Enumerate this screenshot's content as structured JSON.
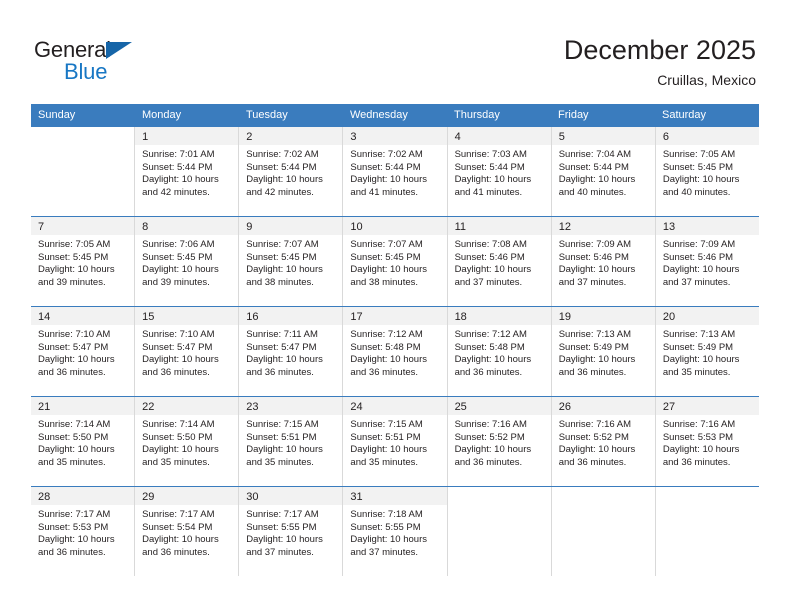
{
  "brand": {
    "name_top": "General",
    "name_bottom": "Blue",
    "accent_color": "#1877c4",
    "triangle_color": "#1665a8"
  },
  "header": {
    "title": "December 2025",
    "location": "Cruillas, Mexico"
  },
  "theme": {
    "header_row_bg": "#3a7cbe",
    "daynum_band_bg": "#f2f2f2",
    "cell_border": "#d9d9d9",
    "text_color": "#231f20"
  },
  "weekdays": [
    "Sunday",
    "Monday",
    "Tuesday",
    "Wednesday",
    "Thursday",
    "Friday",
    "Saturday"
  ],
  "weeks": [
    [
      {
        "day": "",
        "sunrise": "",
        "sunset": "",
        "daylight_line1": "",
        "daylight_line2": ""
      },
      {
        "day": "1",
        "sunrise": "Sunrise: 7:01 AM",
        "sunset": "Sunset: 5:44 PM",
        "daylight_line1": "Daylight: 10 hours",
        "daylight_line2": "and 42 minutes."
      },
      {
        "day": "2",
        "sunrise": "Sunrise: 7:02 AM",
        "sunset": "Sunset: 5:44 PM",
        "daylight_line1": "Daylight: 10 hours",
        "daylight_line2": "and 42 minutes."
      },
      {
        "day": "3",
        "sunrise": "Sunrise: 7:02 AM",
        "sunset": "Sunset: 5:44 PM",
        "daylight_line1": "Daylight: 10 hours",
        "daylight_line2": "and 41 minutes."
      },
      {
        "day": "4",
        "sunrise": "Sunrise: 7:03 AM",
        "sunset": "Sunset: 5:44 PM",
        "daylight_line1": "Daylight: 10 hours",
        "daylight_line2": "and 41 minutes."
      },
      {
        "day": "5",
        "sunrise": "Sunrise: 7:04 AM",
        "sunset": "Sunset: 5:44 PM",
        "daylight_line1": "Daylight: 10 hours",
        "daylight_line2": "and 40 minutes."
      },
      {
        "day": "6",
        "sunrise": "Sunrise: 7:05 AM",
        "sunset": "Sunset: 5:45 PM",
        "daylight_line1": "Daylight: 10 hours",
        "daylight_line2": "and 40 minutes."
      }
    ],
    [
      {
        "day": "7",
        "sunrise": "Sunrise: 7:05 AM",
        "sunset": "Sunset: 5:45 PM",
        "daylight_line1": "Daylight: 10 hours",
        "daylight_line2": "and 39 minutes."
      },
      {
        "day": "8",
        "sunrise": "Sunrise: 7:06 AM",
        "sunset": "Sunset: 5:45 PM",
        "daylight_line1": "Daylight: 10 hours",
        "daylight_line2": "and 39 minutes."
      },
      {
        "day": "9",
        "sunrise": "Sunrise: 7:07 AM",
        "sunset": "Sunset: 5:45 PM",
        "daylight_line1": "Daylight: 10 hours",
        "daylight_line2": "and 38 minutes."
      },
      {
        "day": "10",
        "sunrise": "Sunrise: 7:07 AM",
        "sunset": "Sunset: 5:45 PM",
        "daylight_line1": "Daylight: 10 hours",
        "daylight_line2": "and 38 minutes."
      },
      {
        "day": "11",
        "sunrise": "Sunrise: 7:08 AM",
        "sunset": "Sunset: 5:46 PM",
        "daylight_line1": "Daylight: 10 hours",
        "daylight_line2": "and 37 minutes."
      },
      {
        "day": "12",
        "sunrise": "Sunrise: 7:09 AM",
        "sunset": "Sunset: 5:46 PM",
        "daylight_line1": "Daylight: 10 hours",
        "daylight_line2": "and 37 minutes."
      },
      {
        "day": "13",
        "sunrise": "Sunrise: 7:09 AM",
        "sunset": "Sunset: 5:46 PM",
        "daylight_line1": "Daylight: 10 hours",
        "daylight_line2": "and 37 minutes."
      }
    ],
    [
      {
        "day": "14",
        "sunrise": "Sunrise: 7:10 AM",
        "sunset": "Sunset: 5:47 PM",
        "daylight_line1": "Daylight: 10 hours",
        "daylight_line2": "and 36 minutes."
      },
      {
        "day": "15",
        "sunrise": "Sunrise: 7:10 AM",
        "sunset": "Sunset: 5:47 PM",
        "daylight_line1": "Daylight: 10 hours",
        "daylight_line2": "and 36 minutes."
      },
      {
        "day": "16",
        "sunrise": "Sunrise: 7:11 AM",
        "sunset": "Sunset: 5:47 PM",
        "daylight_line1": "Daylight: 10 hours",
        "daylight_line2": "and 36 minutes."
      },
      {
        "day": "17",
        "sunrise": "Sunrise: 7:12 AM",
        "sunset": "Sunset: 5:48 PM",
        "daylight_line1": "Daylight: 10 hours",
        "daylight_line2": "and 36 minutes."
      },
      {
        "day": "18",
        "sunrise": "Sunrise: 7:12 AM",
        "sunset": "Sunset: 5:48 PM",
        "daylight_line1": "Daylight: 10 hours",
        "daylight_line2": "and 36 minutes."
      },
      {
        "day": "19",
        "sunrise": "Sunrise: 7:13 AM",
        "sunset": "Sunset: 5:49 PM",
        "daylight_line1": "Daylight: 10 hours",
        "daylight_line2": "and 36 minutes."
      },
      {
        "day": "20",
        "sunrise": "Sunrise: 7:13 AM",
        "sunset": "Sunset: 5:49 PM",
        "daylight_line1": "Daylight: 10 hours",
        "daylight_line2": "and 35 minutes."
      }
    ],
    [
      {
        "day": "21",
        "sunrise": "Sunrise: 7:14 AM",
        "sunset": "Sunset: 5:50 PM",
        "daylight_line1": "Daylight: 10 hours",
        "daylight_line2": "and 35 minutes."
      },
      {
        "day": "22",
        "sunrise": "Sunrise: 7:14 AM",
        "sunset": "Sunset: 5:50 PM",
        "daylight_line1": "Daylight: 10 hours",
        "daylight_line2": "and 35 minutes."
      },
      {
        "day": "23",
        "sunrise": "Sunrise: 7:15 AM",
        "sunset": "Sunset: 5:51 PM",
        "daylight_line1": "Daylight: 10 hours",
        "daylight_line2": "and 35 minutes."
      },
      {
        "day": "24",
        "sunrise": "Sunrise: 7:15 AM",
        "sunset": "Sunset: 5:51 PM",
        "daylight_line1": "Daylight: 10 hours",
        "daylight_line2": "and 35 minutes."
      },
      {
        "day": "25",
        "sunrise": "Sunrise: 7:16 AM",
        "sunset": "Sunset: 5:52 PM",
        "daylight_line1": "Daylight: 10 hours",
        "daylight_line2": "and 36 minutes."
      },
      {
        "day": "26",
        "sunrise": "Sunrise: 7:16 AM",
        "sunset": "Sunset: 5:52 PM",
        "daylight_line1": "Daylight: 10 hours",
        "daylight_line2": "and 36 minutes."
      },
      {
        "day": "27",
        "sunrise": "Sunrise: 7:16 AM",
        "sunset": "Sunset: 5:53 PM",
        "daylight_line1": "Daylight: 10 hours",
        "daylight_line2": "and 36 minutes."
      }
    ],
    [
      {
        "day": "28",
        "sunrise": "Sunrise: 7:17 AM",
        "sunset": "Sunset: 5:53 PM",
        "daylight_line1": "Daylight: 10 hours",
        "daylight_line2": "and 36 minutes."
      },
      {
        "day": "29",
        "sunrise": "Sunrise: 7:17 AM",
        "sunset": "Sunset: 5:54 PM",
        "daylight_line1": "Daylight: 10 hours",
        "daylight_line2": "and 36 minutes."
      },
      {
        "day": "30",
        "sunrise": "Sunrise: 7:17 AM",
        "sunset": "Sunset: 5:55 PM",
        "daylight_line1": "Daylight: 10 hours",
        "daylight_line2": "and 37 minutes."
      },
      {
        "day": "31",
        "sunrise": "Sunrise: 7:18 AM",
        "sunset": "Sunset: 5:55 PM",
        "daylight_line1": "Daylight: 10 hours",
        "daylight_line2": "and 37 minutes."
      },
      {
        "day": "",
        "sunrise": "",
        "sunset": "",
        "daylight_line1": "",
        "daylight_line2": ""
      },
      {
        "day": "",
        "sunrise": "",
        "sunset": "",
        "daylight_line1": "",
        "daylight_line2": ""
      },
      {
        "day": "",
        "sunrise": "",
        "sunset": "",
        "daylight_line1": "",
        "daylight_line2": ""
      }
    ]
  ]
}
